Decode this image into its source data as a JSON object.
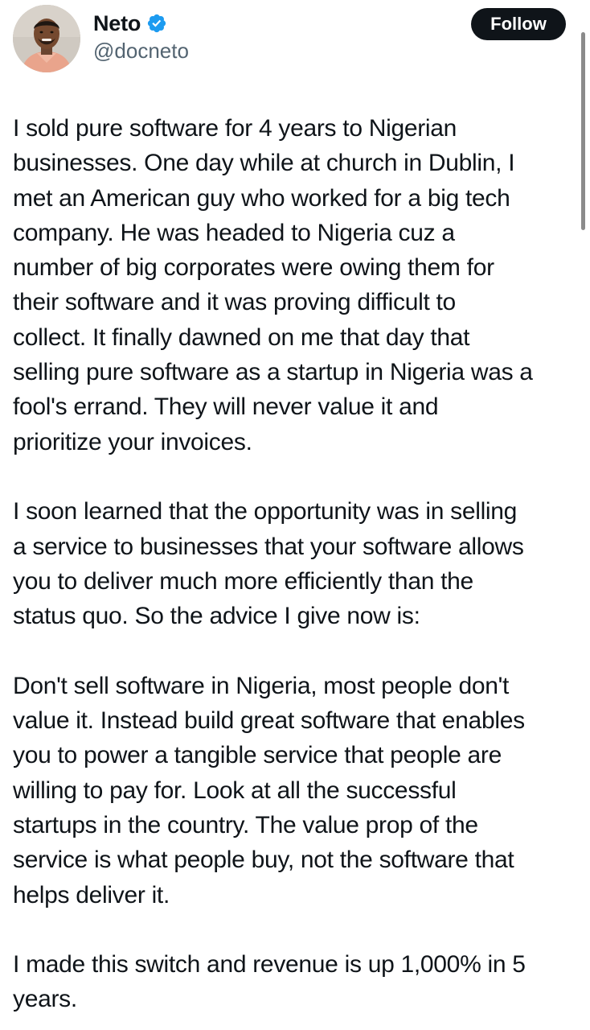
{
  "author": {
    "display_name": "Neto",
    "handle": "@docneto",
    "verified_icon": "verified-badge-icon",
    "avatar": "profile-photo"
  },
  "actions": {
    "follow_label": "Follow"
  },
  "colors": {
    "text": "#0f1419",
    "secondary": "#536471",
    "verified": "#1d9bf0",
    "follow_bg": "#0f1419"
  },
  "tweet": {
    "paragraphs": [
      [
        "I sold pure software for 4 years to Nigerian",
        "businesses. One day while at church in Dublin, I",
        "met an American guy who worked for a big tech",
        "company. He was headed to Nigeria cuz a",
        "number of big corporates were owing them for",
        "their software and it was proving difficult to",
        "collect. It finally dawned on me that day that",
        "selling pure software as a startup in Nigeria was a",
        "fool's errand. They will never value it and",
        "prioritize your invoices."
      ],
      [
        "I soon learned that the opportunity was in selling",
        "a service to businesses that your software allows",
        "you to deliver much more efficiently than the",
        "status quo. So the advice I give now is:"
      ],
      [
        "Don't sell software in Nigeria, most people don't",
        "value it. Instead build great software that enables",
        "you to power a tangible service that people are",
        "willing to pay for. Look at all the successful",
        "startups in the country. The value prop of the",
        "service is what people buy, not the software that",
        "helps deliver it."
      ],
      [
        "I made this switch and revenue is up 1,000% in 5",
        "years."
      ]
    ]
  }
}
